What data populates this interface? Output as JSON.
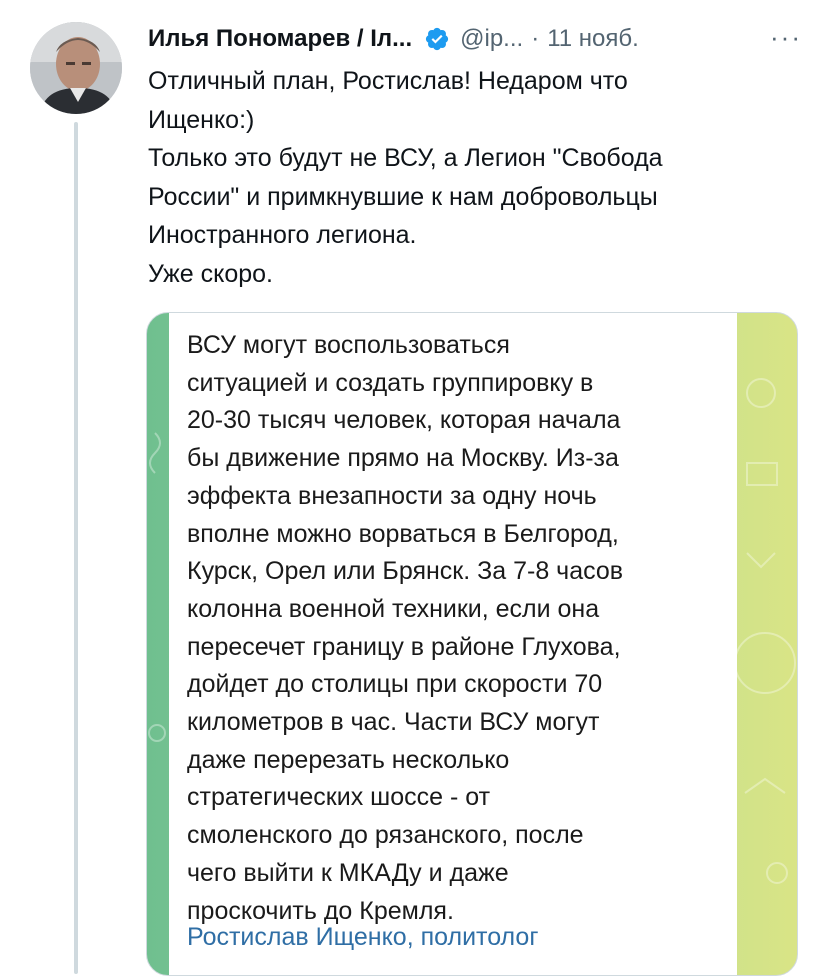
{
  "header": {
    "name": "Илья Пономарев / Іл...",
    "handle": "@ip...",
    "separator": "·",
    "date": "11 нояб.",
    "more": "···"
  },
  "tweet": {
    "lines": [
      "Отличный план, Ростислав! Недаром что",
      "Ищенко:)",
      "Только это будут не ВСУ, а Легион \"Свобода",
      "России\" и примкнувшие к нам добровольцы",
      "Иностранного легиона.",
      "Уже скоро."
    ]
  },
  "quote": {
    "lines": [
      "ВСУ могут воспользоваться",
      "ситуацией и создать группировку в",
      "20-30 тысяч человек, которая начала",
      "бы движение прямо на Москву. Из-за",
      "эффекта внезапности за одну ночь",
      "вполне можно ворваться в Белгород,",
      "Курск, Орел или Брянск. За 7-8 часов",
      "колонна военной техники, если она",
      "пересечет границу в районе Глухова,",
      "дойдет до столицы при скорости 70",
      "километров в час. Части ВСУ могут",
      "даже перерезать несколько",
      "стратегических шоссе - от",
      "смоленского до рязанского, после",
      "чего выйти к МКАДу и даже",
      "проскочить до Кремля."
    ],
    "author": "Ростислав Ищенко, политолог"
  },
  "icons": {
    "verified": "verified-badge-icon",
    "more": "more-options-icon"
  },
  "colors": {
    "verified": "#1d9bf0",
    "secondary_text": "#536471",
    "author_link": "#2f6ea5"
  }
}
